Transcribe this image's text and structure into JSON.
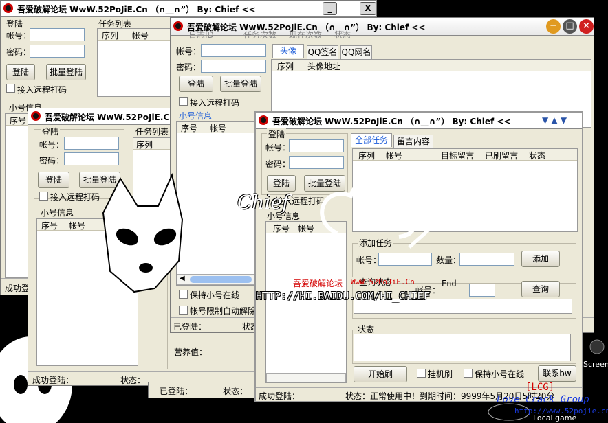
{
  "wins": {
    "a": {
      "title": "吾爱破解论坛  WwW.52PoJiE.Cn  （∩__∩”） By: Chief  <<",
      "min": "_",
      "close": "X"
    },
    "b": {
      "title": "吾爱破解论坛  WwW.52PoJiE.Cn  （∩__∩”）",
      "min": "_",
      "max": "□",
      "close": "X"
    },
    "c": {
      "title": "吾爱破解论坛  WwW.52PoJiE.Cn  （∩__∩”）  By: Chief  <<",
      "min": "−",
      "max": "□",
      "close": "×"
    },
    "d": {
      "title": "吾爱破解论坛  WwW.52PoJiE.Cn  （∩__∩”）  By: Chief  <<",
      "arrows": "▼ ▲ ▼"
    }
  },
  "login": {
    "group": "登陆",
    "account": "帐号：",
    "password": "密码：",
    "login_btn": "登陆",
    "batch_btn": "批量登陆",
    "remote": "接入远程打码"
  },
  "tasks": {
    "title": "任务列表",
    "cols": [
      "序列",
      "帐号"
    ]
  },
  "subs": {
    "title": "小号信息",
    "cols": [
      "序号",
      "帐号"
    ]
  },
  "c_task_header": [
    "日志ID",
    "任务次数",
    "现在次数",
    "状态"
  ],
  "c_tabs": [
    "头像",
    "QQ签名",
    "QQ网名"
  ],
  "c_grid": [
    "序列",
    "头像地址"
  ],
  "c_check1": "保持小号在线",
  "c_check2": "帐号限制自动解除",
  "c_status": {
    "logged": "已登陆：",
    "state": "状态"
  },
  "b_status": "成功登陆：",
  "b_status_state": "状态：",
  "a_status": "成功登",
  "nutrition": "营养值：",
  "bottom_logged": "已登陆：",
  "bottom_state": "状态：",
  "d_tabs": [
    "全部任务",
    "留言内容"
  ],
  "d_grid": [
    "序列",
    "帐号",
    "目标留言",
    "已刷留言",
    "状态"
  ],
  "d_sub_cols": [
    "序号",
    "帐号"
  ],
  "d_sub_title": "小号信息",
  "add": {
    "title": "添加任务",
    "account": "帐号：",
    "qty": "数量：",
    "btn": "添加"
  },
  "query": {
    "title": "查询状态",
    "account": "帐号：",
    "end": "End",
    "btn": "查询"
  },
  "state": {
    "title": "状态"
  },
  "start_btn": "开始刷",
  "hang": "挂机刷",
  "keep": "保持小号在线",
  "contact_btn": "联系bw",
  "d_status": {
    "ok": "成功登陆：",
    "state": "状态：正常使用中！到期时间：9999年5月20日5时20分"
  },
  "overlay": {
    "chief": "Chief",
    "url": "HTTP://HI.BAIDU.COM/HI_CHIEF",
    "forum": "吾爱破解论坛",
    "site": "WwW.52PoJiE.Cn"
  },
  "lcg": {
    "tag": "[LCG]",
    "name": "Love Crack Group",
    "url": "http://www.52pojie.cn"
  },
  "desktop": {
    "screen": "Screen",
    "local": "Local game"
  },
  "colors": {
    "accent": "#1a5bd8",
    "red": "#d40000"
  }
}
